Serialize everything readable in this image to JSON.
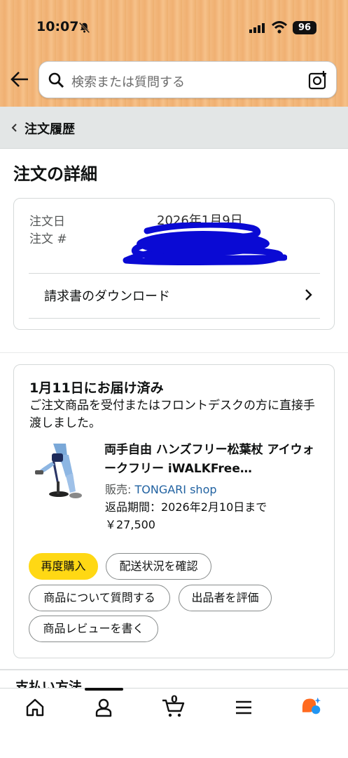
{
  "status": {
    "time": "10:07",
    "battery": "96"
  },
  "search": {
    "placeholder": "検索または質問する"
  },
  "breadcrumb": {
    "label": "注文履歴"
  },
  "page": {
    "title": "注文の詳細"
  },
  "order": {
    "date_label": "注文日",
    "date_value": "2026年1月9日",
    "number_label": "注文 #",
    "invoice_label": "請求書のダウンロード"
  },
  "delivery": {
    "status": "1月11日にお届け済み",
    "message": "ご注文商品を受付またはフロントデスクの方に直接手渡しました。",
    "product_name": "両手自由 ハンズフリー松葉杖 アイウォークフリー iWALKFree…",
    "seller_prefix": "販売: ",
    "seller_name": "TONGARI shop",
    "return_period": "返品期間：2026年2月10日まで",
    "price": "￥27,500"
  },
  "actions": {
    "buy_again": "再度購入",
    "track": "配送状況を確認",
    "ask": "商品について質問する",
    "rate_seller": "出品者を評価",
    "review": "商品レビューを書く"
  },
  "next_section": {
    "title_partial": "支払い方法"
  },
  "tabbar": {
    "cart_count": "0"
  }
}
